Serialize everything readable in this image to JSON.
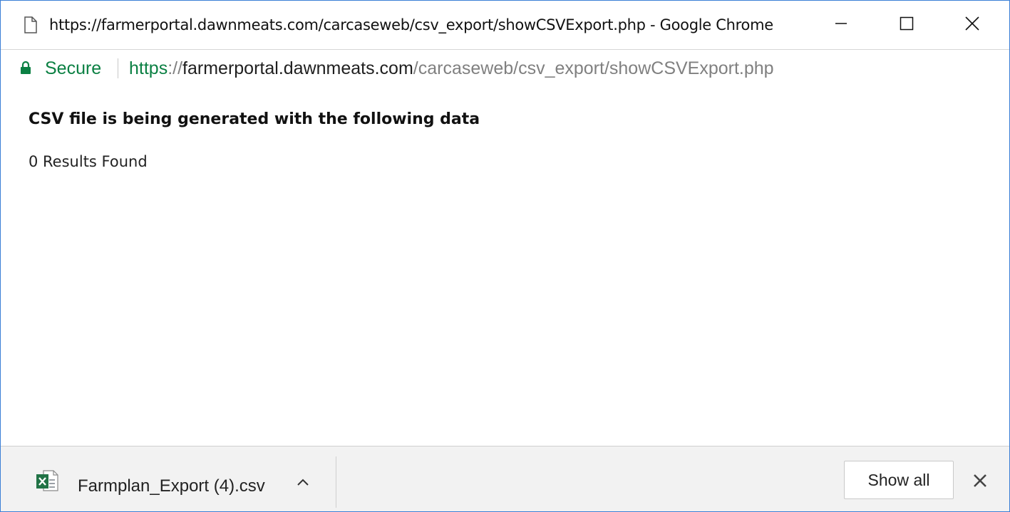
{
  "window": {
    "title": "https://farmerportal.dawnmeats.com/carcaseweb/csv_export/showCSVExport.php - Google Chrome"
  },
  "addressbar": {
    "secure_label": "Secure",
    "url_scheme": "https",
    "url_separator": "://",
    "url_host": "farmerportal.dawnmeats.com",
    "url_path": "/carcaseweb/csv_export/showCSVExport.php"
  },
  "page": {
    "heading": "CSV file is being generated with the following data",
    "results": "0 Results Found"
  },
  "download_bar": {
    "file_name": "Farmplan_Export (4).csv",
    "show_all_label": "Show all"
  },
  "icons": {
    "page": "page-icon",
    "lock": "lock-icon",
    "excel_file": "excel-file-icon",
    "chevron": "chevron-up-icon",
    "minimize": "minimize-icon",
    "maximize": "maximize-icon",
    "close": "close-icon"
  },
  "colors": {
    "secure_green": "#0b8043",
    "window_border": "#3b7fd6",
    "download_bar_bg": "#f2f2f2",
    "excel_green": "#217346"
  }
}
